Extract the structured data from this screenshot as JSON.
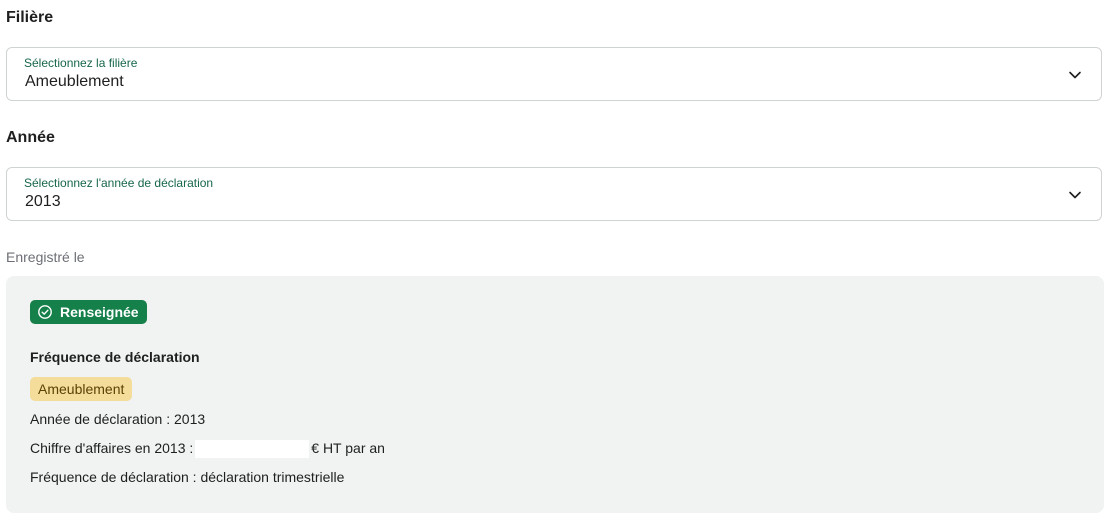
{
  "filiere": {
    "title": "Filière",
    "select_caption": "Sélectionnez la filière",
    "select_value": "Ameublement"
  },
  "annee": {
    "title": "Année",
    "select_caption": "Sélectionnez l'année de déclaration",
    "select_value": "2013"
  },
  "saved_label": "Enregistré le",
  "panel": {
    "status_badge": "Renseignée",
    "heading": "Fréquence de déclaration",
    "tag": "Ameublement",
    "year_line": "Année de déclaration : 2013",
    "revenue_prefix": "Chiffre d'affaires en 2013 :",
    "revenue_suffix": "€ HT par an",
    "frequency_line": "Fréquence de déclaration : déclaration trimestrielle"
  },
  "colors": {
    "accent_green": "#16804a",
    "caption_green": "#17664a",
    "tag_background": "#f4dc9b",
    "panel_background": "#f0f3f2"
  },
  "icons": {
    "select_arrow": "chevron-down-icon",
    "status": "check-circle-icon"
  }
}
